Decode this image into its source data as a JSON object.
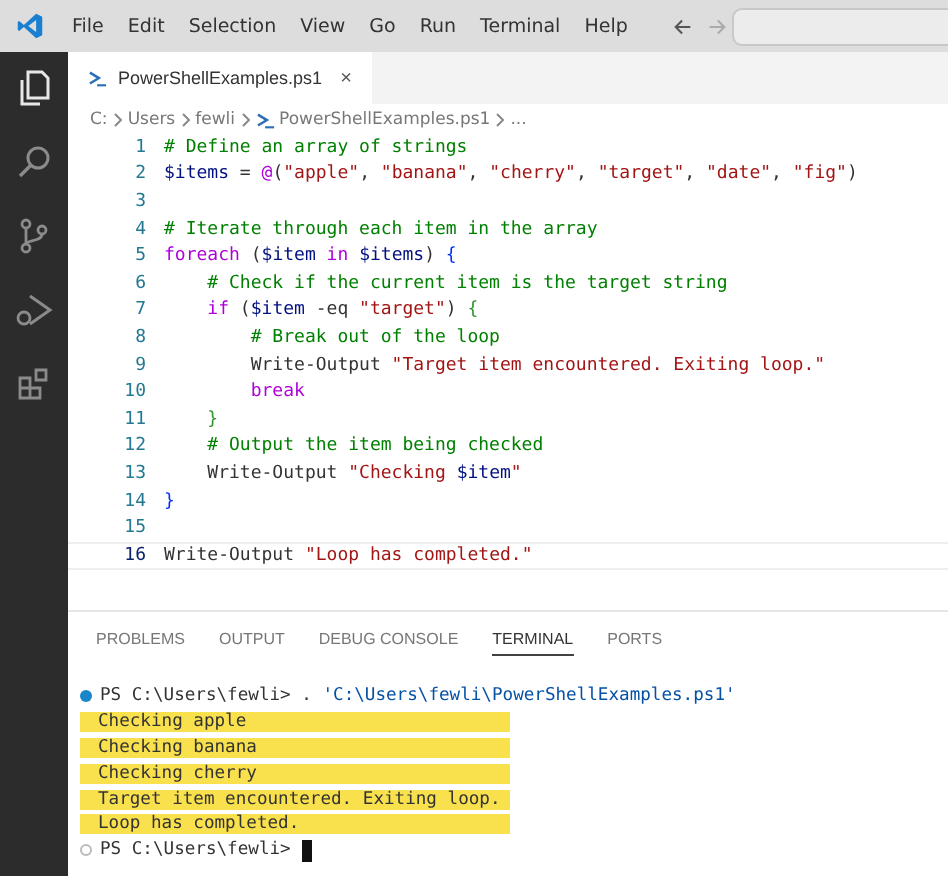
{
  "menu": [
    "File",
    "Edit",
    "Selection",
    "View",
    "Go",
    "Run",
    "Terminal",
    "Help"
  ],
  "activity_bar": [
    {
      "kind": "files",
      "selected": true
    },
    {
      "kind": "search",
      "selected": false
    },
    {
      "kind": "source-control",
      "selected": false
    },
    {
      "kind": "run-debug",
      "selected": false
    },
    {
      "kind": "extensions",
      "selected": false
    }
  ],
  "editor_tabs": [
    {
      "label": "PowerShellExamples.ps1",
      "close": "×",
      "selected": true
    }
  ],
  "breadcrumb": [
    "C:",
    "Users",
    "fewli",
    "PowerShellExamples.ps1",
    "..."
  ],
  "code": [
    {
      "number": "1",
      "current": false,
      "tokens": [
        {
          "kind": "comment",
          "text": "# Define an array of strings"
        }
      ]
    },
    {
      "number": "2",
      "current": false,
      "tokens": [
        {
          "kind": "variable",
          "text": "$items"
        },
        {
          "kind": "plain",
          "text": " = "
        },
        {
          "kind": "keyword",
          "text": "@"
        },
        {
          "kind": "plain",
          "text": "("
        },
        {
          "kind": "string",
          "text": "\"apple\""
        },
        {
          "kind": "plain",
          "text": ", "
        },
        {
          "kind": "string",
          "text": "\"banana\""
        },
        {
          "kind": "plain",
          "text": ", "
        },
        {
          "kind": "string",
          "text": "\"cherry\""
        },
        {
          "kind": "plain",
          "text": ", "
        },
        {
          "kind": "string",
          "text": "\"target\""
        },
        {
          "kind": "plain",
          "text": ", "
        },
        {
          "kind": "string",
          "text": "\"date\""
        },
        {
          "kind": "plain",
          "text": ", "
        },
        {
          "kind": "string",
          "text": "\"fig\""
        },
        {
          "kind": "plain",
          "text": ")"
        }
      ]
    },
    {
      "number": "3",
      "current": false
    },
    {
      "number": "4",
      "current": false,
      "tokens": [
        {
          "kind": "comment",
          "text": "# Iterate through each item in the array"
        }
      ]
    },
    {
      "number": "5",
      "current": false,
      "tokens": [
        {
          "kind": "keyword",
          "text": "foreach"
        },
        {
          "kind": "plain",
          "text": " ("
        },
        {
          "kind": "variable",
          "text": "$item"
        },
        {
          "kind": "keyword",
          "text": " in "
        },
        {
          "kind": "variable",
          "text": "$items"
        },
        {
          "kind": "plain",
          "text": ") "
        },
        {
          "kind": "bracket",
          "text": "{"
        }
      ]
    },
    {
      "number": "6",
      "current": false,
      "tokens": [
        {
          "kind": "comment",
          "text": "    # Check if the current item is the target string"
        }
      ]
    },
    {
      "number": "7",
      "current": false,
      "tokens": [
        {
          "kind": "keyword",
          "text": "    if"
        },
        {
          "kind": "plain",
          "text": " ("
        },
        {
          "kind": "variable",
          "text": "$item"
        },
        {
          "kind": "plain",
          "text": " -eq "
        },
        {
          "kind": "string",
          "text": "\"target\""
        },
        {
          "kind": "plain",
          "text": ") "
        },
        {
          "kind": "bracket2",
          "text": "{"
        }
      ]
    },
    {
      "number": "8",
      "current": false,
      "tokens": [
        {
          "kind": "comment",
          "text": "        # Break out of the loop"
        }
      ]
    },
    {
      "number": "9",
      "current": false,
      "tokens": [
        {
          "kind": "plain",
          "text": "        Write-Output "
        },
        {
          "kind": "string",
          "text": "\"Target item encountered. Exiting loop.\""
        }
      ]
    },
    {
      "number": "10",
      "current": false,
      "tokens": [
        {
          "kind": "keyword",
          "text": "        break"
        }
      ]
    },
    {
      "number": "11",
      "current": false,
      "tokens": [
        {
          "kind": "bracket2",
          "text": "    }"
        }
      ]
    },
    {
      "number": "12",
      "current": false,
      "tokens": [
        {
          "kind": "comment",
          "text": "    # Output the item being checked"
        }
      ]
    },
    {
      "number": "13",
      "current": false,
      "tokens": [
        {
          "kind": "plain",
          "text": "    Write-Output "
        },
        {
          "kind": "string",
          "text": "\"Checking "
        },
        {
          "kind": "variable",
          "text": "$item"
        },
        {
          "kind": "string",
          "text": "\""
        }
      ]
    },
    {
      "number": "14",
      "current": false,
      "tokens": [
        {
          "kind": "bracket",
          "text": "}"
        }
      ]
    },
    {
      "number": "15",
      "current": false
    },
    {
      "number": "16",
      "current": true,
      "tokens": [
        {
          "kind": "plain",
          "text": "Write-Output "
        },
        {
          "kind": "string",
          "text": "\"Loop has completed.\""
        }
      ]
    }
  ],
  "panel_tabs": [
    {
      "label": "PROBLEMS",
      "selected": false
    },
    {
      "label": "OUTPUT",
      "selected": false
    },
    {
      "label": "DEBUG CONSOLE",
      "selected": false
    },
    {
      "label": "TERMINAL",
      "selected": true
    },
    {
      "label": "PORTS",
      "selected": false
    }
  ],
  "terminal": [
    {
      "kind": "prompt",
      "done": true,
      "tokens": [
        {
          "kind": "plain",
          "text": "PS C:\\Users\\fewli> . "
        },
        {
          "kind": "path",
          "text": "'C:\\Users\\fewli\\PowerShellExamples.ps1'"
        }
      ]
    },
    {
      "kind": "output",
      "highlighted": true,
      "text": "Checking apple"
    },
    {
      "kind": "output",
      "highlighted": true,
      "text": "Checking banana"
    },
    {
      "kind": "output",
      "highlighted": true,
      "text": "Checking cherry"
    },
    {
      "kind": "output",
      "highlighted": true,
      "text": "Target item encountered. Exiting loop."
    },
    {
      "kind": "output",
      "highlighted": true,
      "text": "Loop has completed."
    },
    {
      "kind": "prompt",
      "done": false,
      "cursor": true,
      "tokens": [
        {
          "kind": "plain",
          "text": "PS C:\\Users\\fewli> "
        }
      ]
    }
  ]
}
